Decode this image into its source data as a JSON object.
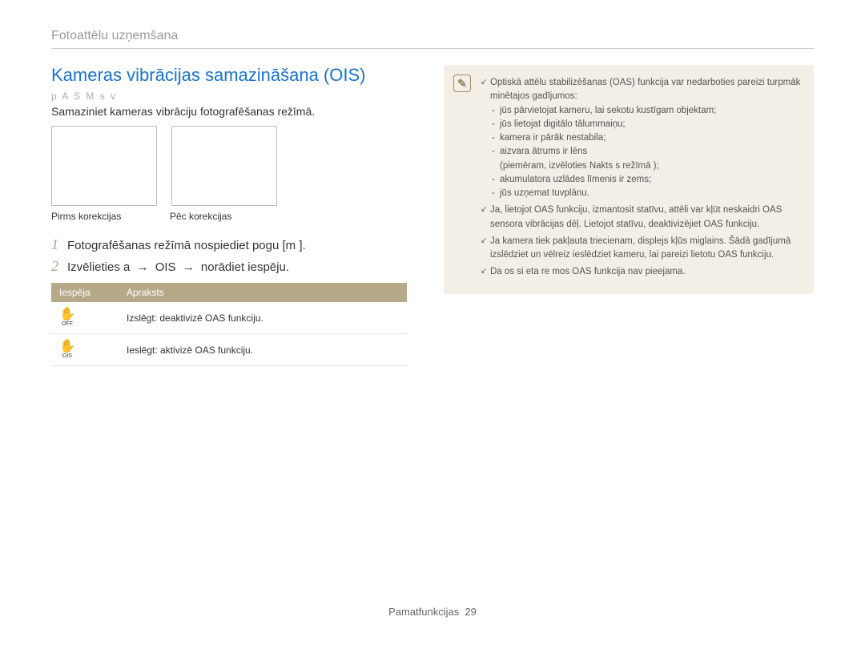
{
  "header": "Fotoattēlu uzņemšana",
  "left": {
    "title": "Kameras vibrācijas samazināšana (OIS)",
    "modes": "p A S M s v",
    "intro": "Samaziniet kameras vibrāciju fotografēšanas režīmā.",
    "caption_before": "Pirms korekcijas",
    "caption_after": "Pēc korekcijas",
    "steps": [
      {
        "num": "1",
        "text": "Fotografēšanas režīmā nospiediet pogu [m    ]."
      },
      {
        "num": "2",
        "pre": "Izvēlieties a  ",
        "mid": "OIS",
        "post": "norādiet iespēju."
      }
    ],
    "table": {
      "headers": [
        "Iespēja",
        "Apraksts"
      ],
      "rows": [
        {
          "icon_sub": "OFF",
          "desc": "Izslēgt: deaktivizē OAS funkciju."
        },
        {
          "icon_sub": "OIS",
          "desc": "Ieslēgt: aktivizē OAS funkciju."
        }
      ]
    }
  },
  "right": {
    "notes": [
      {
        "text": "Optiskā attēlu stabilizēšanas (OAS) funkcija var nedarboties pareizi turpmāk minētajos gadījumos:",
        "sub": [
          "jūs pārvietojat kameru, lai sekotu kustīgam objektam;",
          "jūs lietojat digitālo tālummaiņu;",
          "kamera ir pārāk nestabila;",
          "aizvara ātrums ir lēns\n(piemēram, izvēloties Nakts s      režīmā   );",
          "akumulatora uzlādes līmenis ir zems;",
          "jūs uzņemat tuvplānu."
        ]
      },
      {
        "text": "Ja, lietojot OAS funkciju, izmantosit statīvu, attēli var kļūt neskaidri OAS sensora vibrācijas dēļ. Lietojot statīvu, deaktivizējiet OAS funkciju."
      },
      {
        "text": "Ja kamera tiek pakļauta triecienam, displejs kļūs miglains.   Šādā gadījumā izslēdziet un vēlreiz ieslēdziet kameru, lai pareizi lietotu OAS funkciju."
      },
      {
        "text": "Da os si eta re  mos OAS funkcija nav pieejama."
      }
    ]
  },
  "footer": {
    "label": "Pamatfunkcijas",
    "page": "29"
  }
}
